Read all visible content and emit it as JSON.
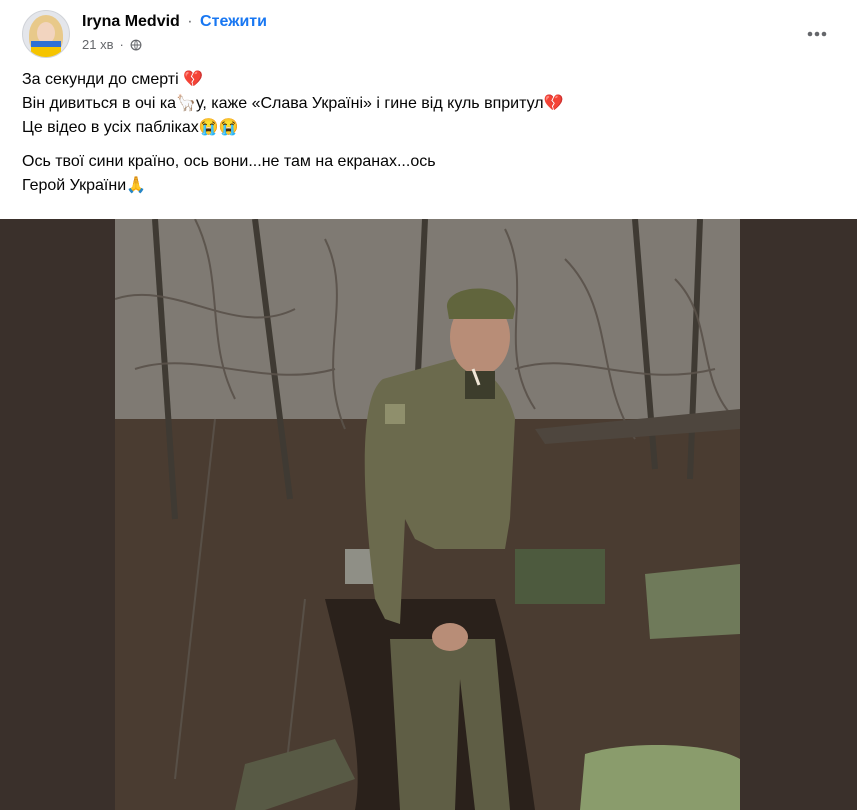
{
  "post": {
    "author": "Iryna Medvid",
    "separator": "·",
    "follow_label": "Стежити",
    "time": "21 хв",
    "privacy_icon": "globe-icon",
    "more_icon": "more-icon",
    "text_lines": [
      "За секунди до смерті 💔",
      "Він дивиться в очі ка🦙у, каже «Слава Україні» і гине від куль впритул💔",
      "Це відео в усіх пабліках😭😭"
    ],
    "text_lines_2": [
      "Ось твої сини країно, ось вони...не там на екранах...ось",
      "Герой України🙏"
    ]
  },
  "colors": {
    "accent": "#1877f2",
    "secondary_text": "#65676b",
    "video_background": "#3a302b"
  }
}
